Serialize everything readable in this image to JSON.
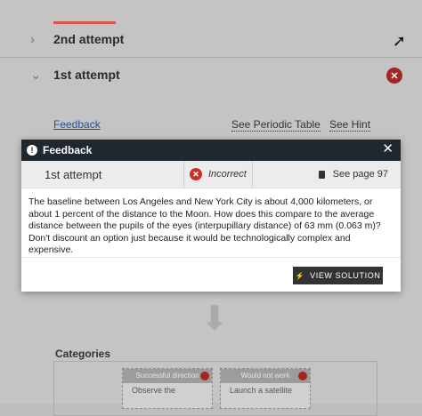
{
  "background": {
    "attempts": [
      {
        "label": "2nd attempt"
      },
      {
        "label": "1st attempt"
      }
    ],
    "links": {
      "feedback": "Feedback",
      "periodic_table": "See Periodic Table",
      "hint": "See Hint"
    },
    "categories_label": "Categories",
    "category_cards": [
      {
        "header": "Successful direction",
        "body": "Observe the"
      },
      {
        "header": "Would not work",
        "body": "Launch a satellite"
      }
    ]
  },
  "modal": {
    "title": "Feedback",
    "attempt_name": "1st attempt",
    "status": "Incorrect",
    "page_ref": "See page 97",
    "message": "The baseline between Los Angeles and New York City is about 4,000 kilometers, or about 1 percent of the distance to the Moon. How does this compare to the average distance between the pupils of the eyes (interpupillary distance) of 63 mm (0.063 m)? Don't discount an option just because it would be technologically complex and expensive.",
    "view_solution_label": "VIEW SOLUTION"
  },
  "colors": {
    "header_bg": "#1f2830",
    "incorrect_red": "#c9302c",
    "button_bg": "#333333"
  }
}
